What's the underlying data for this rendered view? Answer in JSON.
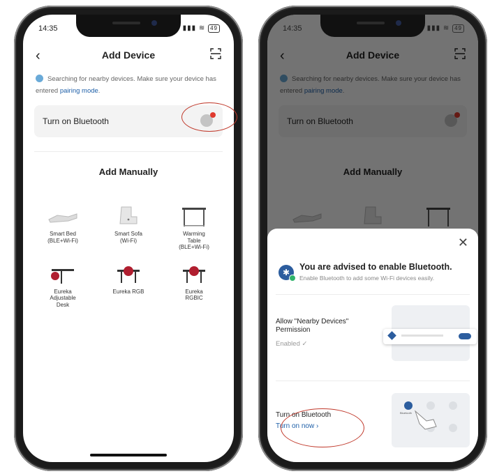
{
  "status": {
    "time": "14:35",
    "battery": "49"
  },
  "header": {
    "title": "Add Device",
    "back_icon": "chevron-left-icon",
    "scan_icon": "scan-icon"
  },
  "notice": {
    "text": "Searching for nearby devices. Make sure your device has entered ",
    "link": "pairing mode",
    "suffix": "."
  },
  "bluetooth_row": {
    "label": "Turn on Bluetooth"
  },
  "manual": {
    "title": "Add Manually",
    "devices": [
      {
        "label": "Smart Bed\n(BLE+Wi-Fi)"
      },
      {
        "label": "Smart Sofa\n(Wi-Fi)"
      },
      {
        "label": "Warming\nTable\n(BLE+Wi-Fi)"
      },
      {
        "label": "Eureka\nAdjustable\nDesk"
      },
      {
        "label": "Eureka RGB"
      },
      {
        "label": "Eureka\nRGBIC"
      }
    ]
  },
  "sheet": {
    "title": "You are advised to enable Bluetooth.",
    "subtitle": "Enable Bluetooth to add some Wi-Fi devices easily.",
    "permission_label": "Allow \"Nearby Devices\" Permission",
    "permission_status": "Enabled ✓",
    "bt_label": "Turn on Bluetooth",
    "bt_action": "Turn on now ›",
    "illus_bt_text": "Bluetooth"
  },
  "colors": {
    "accent": "#1e5fa8",
    "highlight": "#c0392b",
    "badge": "#e03a2e"
  }
}
